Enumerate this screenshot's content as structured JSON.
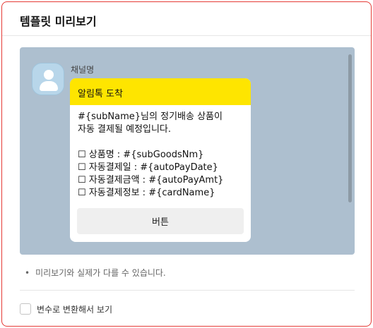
{
  "header": {
    "title": "템플릿 미리보기"
  },
  "preview": {
    "channel_name": "채널명",
    "bubble": {
      "header": "알림톡 도착",
      "body_lines": [
        "#{subName}님의 정기배송 상품이",
        "자동 결제될 예정입니다.",
        "",
        "☐ 상품명 : #{subGoodsNm}",
        "☐ 자동결제일 : #{autoPayDate}",
        "☐ 자동결제금액 : #{autoPayAmt}",
        "☐ 자동결제정보 : #{cardName}"
      ],
      "button_label": "버튼"
    },
    "avatar_icon": "user-avatar-icon"
  },
  "note": {
    "bullet": "•",
    "text": "미리보기와 실제가 다를 수 있습니다."
  },
  "option": {
    "label": "변수로 변환해서 보기",
    "checked": false
  },
  "colors": {
    "border_accent": "#e53935",
    "preview_bg": "#adbfcf",
    "bubble_header": "#fee500"
  }
}
